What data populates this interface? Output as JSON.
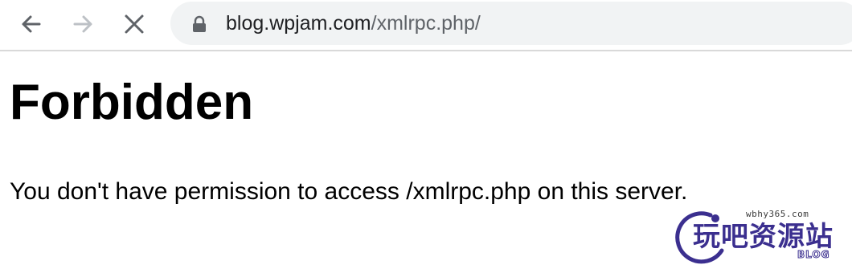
{
  "browser": {
    "back_icon": "arrow-left-icon",
    "forward_icon": "arrow-right-icon",
    "stop_icon": "close-icon",
    "lock_icon": "lock-icon",
    "url": {
      "host": "blog.wpjam.com",
      "path": "/xmlrpc.php/"
    },
    "colors": {
      "omnibox_bg": "#f1f3f4",
      "host_text": "#202124",
      "path_text": "#5f6368"
    }
  },
  "page": {
    "title": "Forbidden",
    "message": "You don't have permission to access /xmlrpc.php on this server."
  },
  "watermark": {
    "site": "wbhy365.com",
    "brand": "玩吧资源站",
    "tag": "BLOG",
    "color": "#3b2f8f"
  }
}
